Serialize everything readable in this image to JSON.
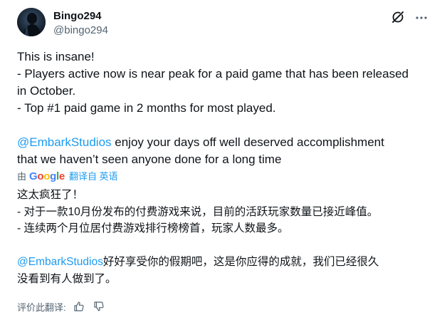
{
  "author": {
    "display_name": "Bingo294",
    "handle": "@bingo294",
    "avatar_icon": "avatar-dark-figure"
  },
  "header_icons": {
    "grok": "grok-icon",
    "more": "more-options-icon"
  },
  "tweet": {
    "lines": [
      "This is insane!",
      "- Players active now is near peak for a paid game that has been released",
      "in October.",
      "- Top #1 paid game in 2 months for most played."
    ],
    "mention": "@EmbarkStudios",
    "mention_rest_line1": " enjoy your days off well deserved accomplishment",
    "mention_line2": "that we haven’t seen anyone done for a long time"
  },
  "translation_bar": {
    "by_label": "由",
    "provider": "Google",
    "action_label": "翻译自 英语"
  },
  "translation": {
    "lines": [
      "这太疯狂了！",
      "- 对于一款10月份发布的付费游戏来说，目前的活跃玩家数量已接近峰值。",
      "- 连续两个月位居付费游戏排行榜榜首，玩家人数最多。"
    ],
    "mention": "@EmbarkStudios",
    "mention_rest_line1": "好好享受你的假期吧，这是你应得的成就，我们已经很久",
    "mention_line2": "没看到有人做到了。"
  },
  "rating": {
    "label": "评价此翻译:",
    "up_icon": "thumbs-up-icon",
    "down_icon": "thumbs-down-icon"
  },
  "colors": {
    "text": "#0f1419",
    "secondary": "#536471",
    "link": "#1d9bf0"
  }
}
